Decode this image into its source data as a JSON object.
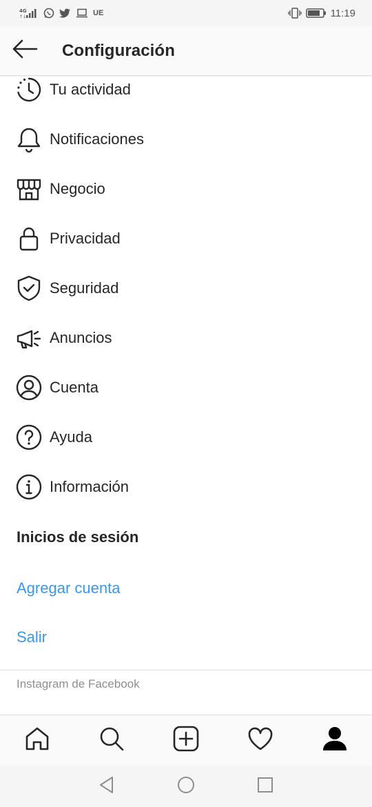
{
  "status_bar": {
    "network": "4G",
    "carrier_tag": "UE",
    "time": "11:19",
    "icons": [
      "signal-icon",
      "whatsapp-icon",
      "twitter-icon",
      "laptop-icon",
      "vibrate-icon",
      "battery-icon"
    ]
  },
  "header": {
    "title": "Configuración",
    "back_icon": "arrow-left-icon"
  },
  "menu": {
    "items": [
      {
        "label": "Tu actividad",
        "icon": "activity-clock-icon"
      },
      {
        "label": "Notificaciones",
        "icon": "bell-icon"
      },
      {
        "label": "Negocio",
        "icon": "shop-icon"
      },
      {
        "label": "Privacidad",
        "icon": "lock-icon"
      },
      {
        "label": "Seguridad",
        "icon": "shield-check-icon"
      },
      {
        "label": "Anuncios",
        "icon": "megaphone-icon"
      },
      {
        "label": "Cuenta",
        "icon": "account-circle-icon"
      },
      {
        "label": "Ayuda",
        "icon": "help-circle-icon"
      },
      {
        "label": "Información",
        "icon": "info-circle-icon"
      }
    ]
  },
  "logins": {
    "section_title": "Inicios de sesión",
    "add_account": "Agregar cuenta",
    "logout": "Salir"
  },
  "footer": {
    "text": "Instagram de Facebook"
  },
  "tab_bar": {
    "tabs": [
      "home-icon",
      "search-icon",
      "new-post-icon",
      "heart-icon",
      "profile-icon"
    ],
    "active_tab": "profile-icon"
  },
  "system_nav": {
    "buttons": [
      "back-triangle-icon",
      "home-circle-icon",
      "recents-square-icon"
    ]
  },
  "colors": {
    "text_primary": "#262626",
    "link_blue": "#3897f0",
    "muted": "#8e8e8e",
    "divider": "#dbdbdb",
    "bar_bg": "#fafafa"
  }
}
